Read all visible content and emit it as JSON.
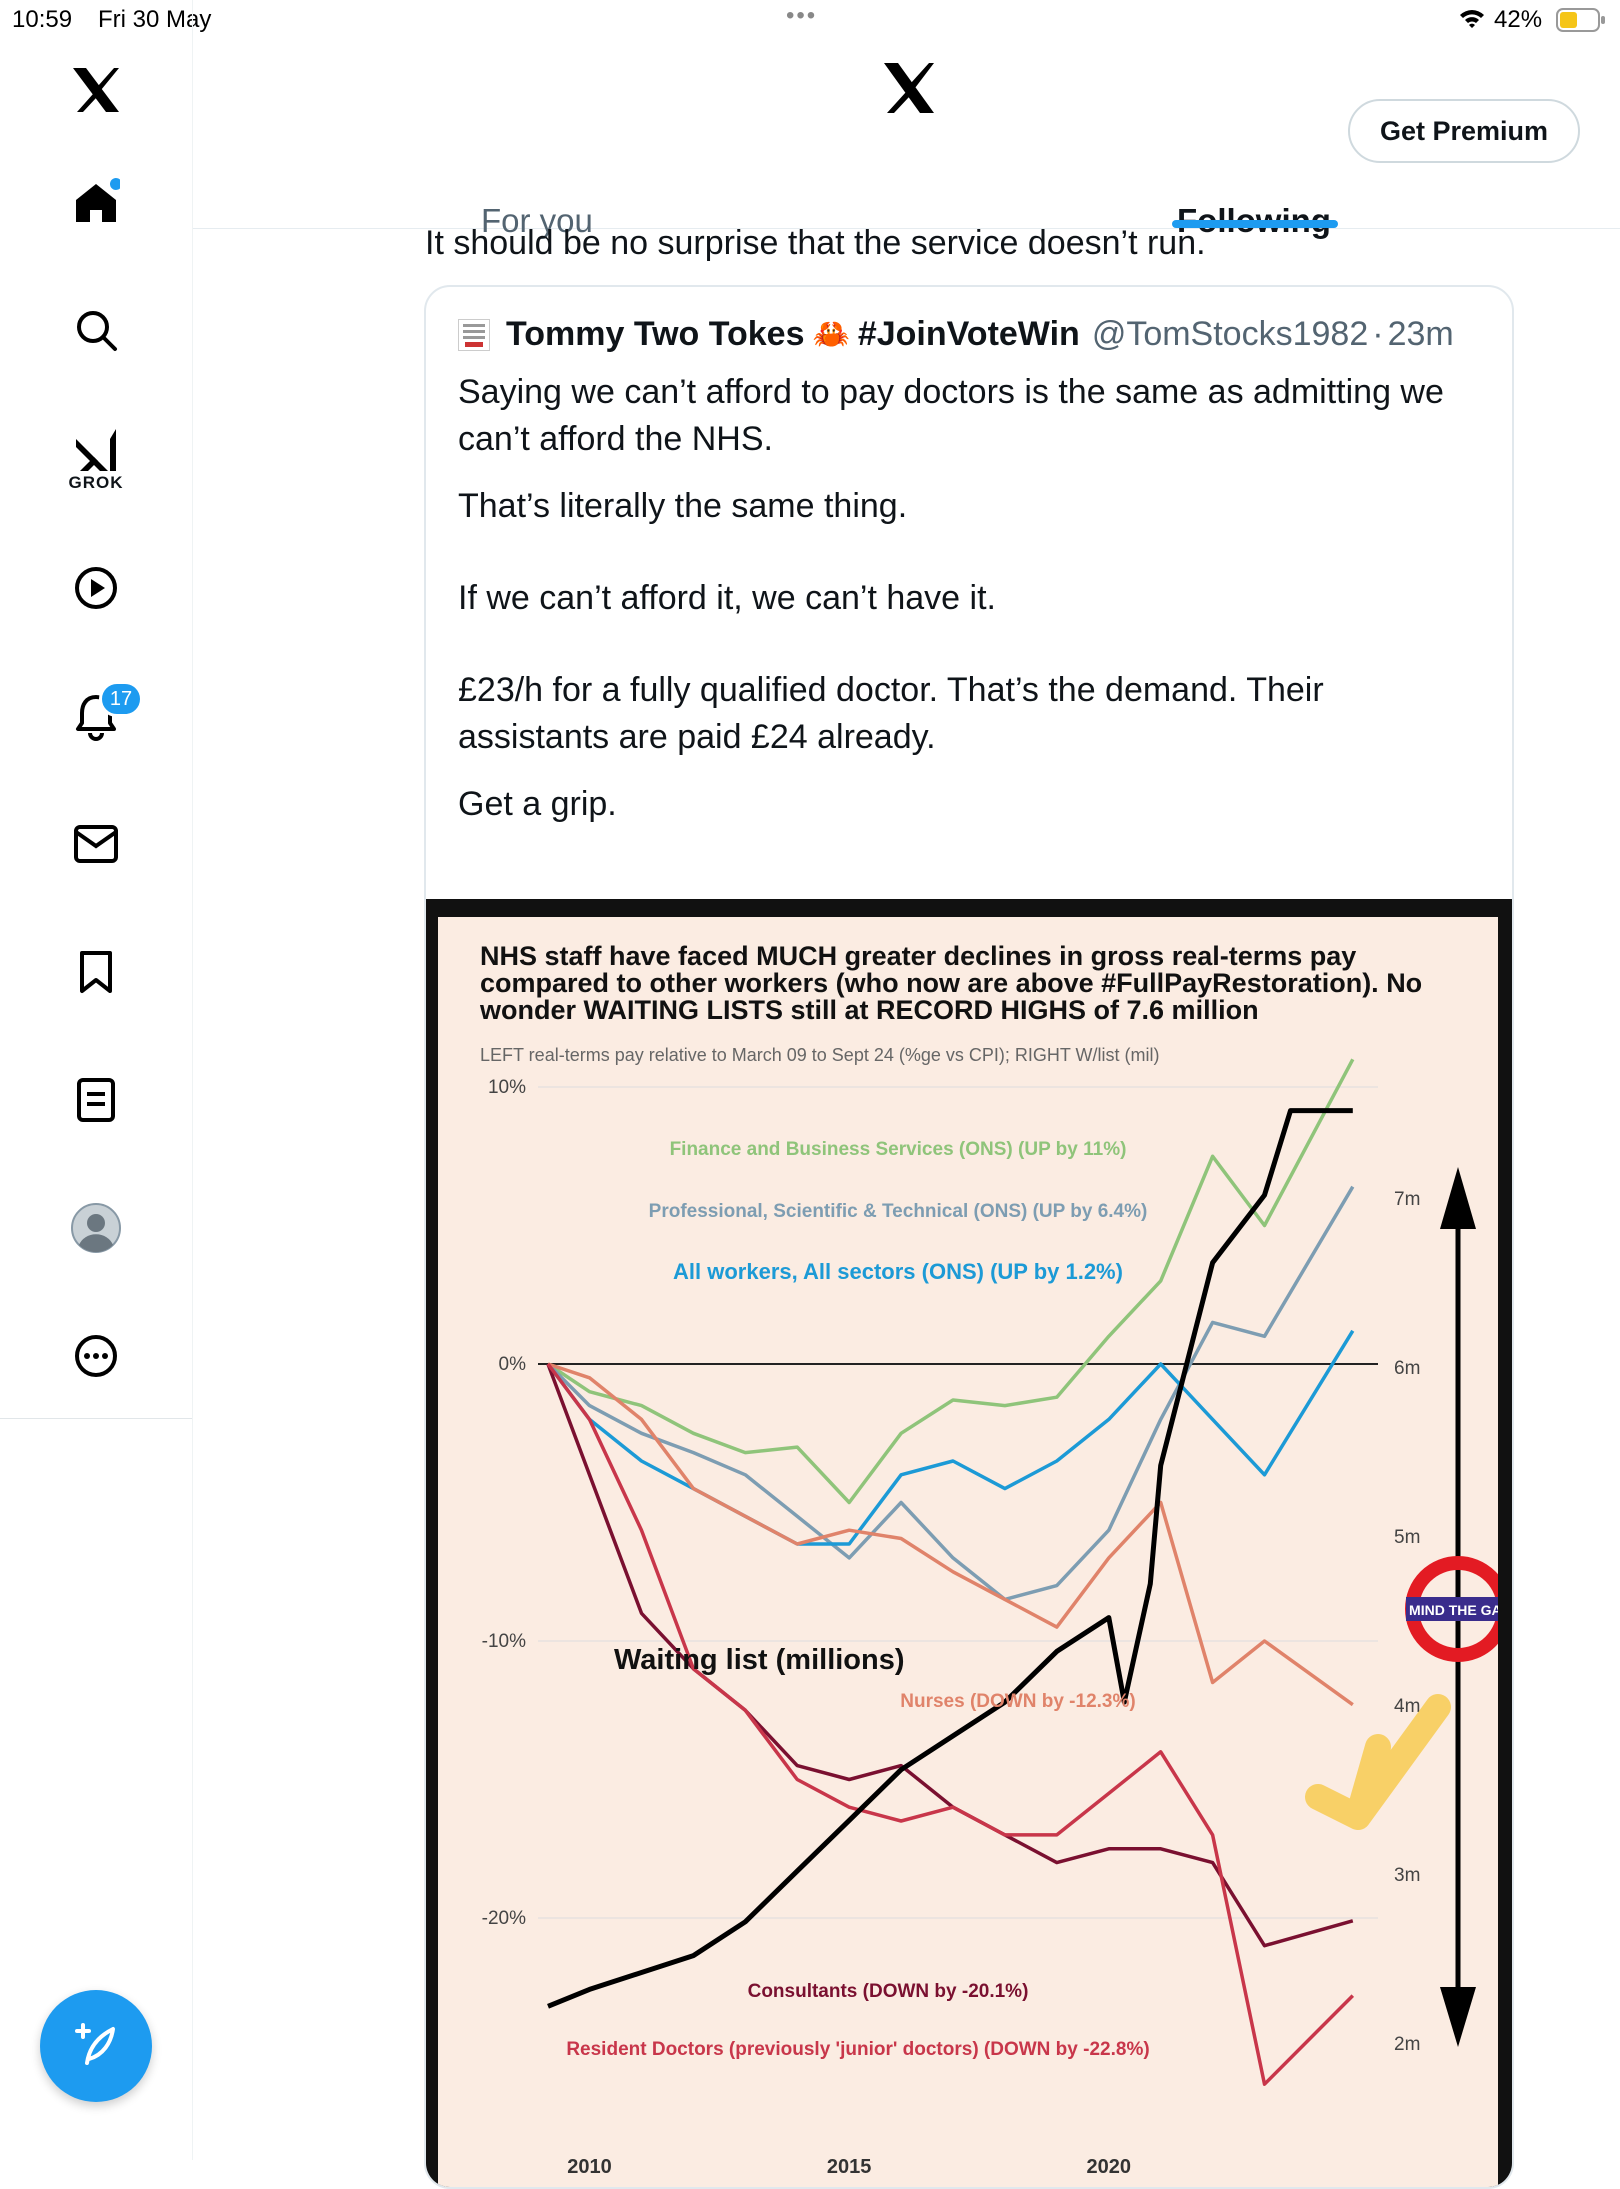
{
  "status": {
    "time": "10:59",
    "date": "Fri 30 May",
    "dots": "•••",
    "battery": "42%"
  },
  "sidebar": {
    "items": [
      {
        "name": "x-logo-icon"
      },
      {
        "name": "home-icon"
      },
      {
        "name": "search-icon"
      },
      {
        "name": "grok-icon",
        "label": "GROK"
      },
      {
        "name": "video-icon"
      },
      {
        "name": "notifications-icon",
        "badge": "17"
      },
      {
        "name": "messages-icon"
      },
      {
        "name": "bookmarks-icon"
      },
      {
        "name": "lists-icon"
      },
      {
        "name": "profile-icon"
      },
      {
        "name": "more-icon"
      }
    ]
  },
  "header": {
    "get_premium": "Get Premium",
    "tabs": [
      "For you",
      "Following"
    ],
    "active_tab": "Following"
  },
  "tweet": {
    "text_fragment": "It should be no surprise that the service doesn’t run.",
    "quote": {
      "name": "Tommy Two Tokes",
      "emoji": "🦀",
      "hashtag": "#JoinVoteWin",
      "handle": "@TomStocks1982",
      "sep": "·",
      "time": "23m",
      "paragraphs": [
        "Saying we can’t afford to pay doctors is the same as admitting we can’t afford the NHS.",
        "That’s literally the same thing.",
        "If we can’t afford it, we can’t have it.",
        "£23/h for a fully qualified doctor. That’s the demand. Their assistants are paid £24 already.",
        "Get a grip."
      ]
    }
  },
  "chart_data": {
    "type": "line",
    "title": "NHS staff have faced MUCH greater declines in gross real-terms pay compared to other workers (who now are above #FullPayRestoration). No wonder WAITING LISTS still at RECORD HIGHS of 7.6 million",
    "subtitle": "LEFT real-terms pay relative to March 09 to Sept 24 (%ge vs CPI); RIGHT W/list (mil)",
    "x_ticks": [
      "2010",
      "2015",
      "2020"
    ],
    "y_left_ticks": [
      "10%",
      "0%",
      "-10%",
      "-20%"
    ],
    "y_right_ticks": [
      "7m",
      "6m",
      "5m",
      "4m",
      "3m",
      "2m"
    ],
    "xlim": [
      2009.2,
      2024.8
    ],
    "ylim_left": [
      -20,
      10
    ],
    "ylim_right": [
      2,
      7
    ],
    "series": [
      {
        "name": "Finance and Business Services (ONS) (UP by 11%)",
        "color": "#8fc47a",
        "x": [
          2009.2,
          2010,
          2011,
          2012,
          2013,
          2014,
          2015,
          2016,
          2017,
          2018,
          2019,
          2020,
          2021,
          2022,
          2023,
          2024.7
        ],
        "y": [
          0,
          -1,
          -1.5,
          -2.5,
          -3.2,
          -3,
          -5,
          -2.5,
          -1.3,
          -1.5,
          -1.2,
          1,
          3,
          7.5,
          5,
          11
        ]
      },
      {
        "name": "Professional, Scientific & Technical (ONS) (UP by 6.4%)",
        "color": "#7d9db2",
        "x": [
          2009.2,
          2010,
          2011,
          2012,
          2013,
          2014,
          2015,
          2016,
          2017,
          2018,
          2019,
          2020,
          2021,
          2022,
          2023,
          2024.7
        ],
        "y": [
          0,
          -1.5,
          -2.5,
          -3.2,
          -4,
          -5.5,
          -7,
          -5,
          -7,
          -8.5,
          -8,
          -6,
          -2,
          1.5,
          1,
          6.4
        ]
      },
      {
        "name": "All workers, All sectors (ONS) (UP by 1.2%)",
        "color": "#1c9ad6",
        "x": [
          2009.2,
          2010,
          2011,
          2012,
          2013,
          2014,
          2015,
          2016,
          2017,
          2018,
          2019,
          2020,
          2021,
          2022,
          2023,
          2024.7
        ],
        "y": [
          0,
          -2,
          -3.5,
          -4.5,
          -5.5,
          -6.5,
          -6.5,
          -4,
          -3.5,
          -4.5,
          -3.5,
          -2,
          0,
          -2,
          -4,
          1.2
        ]
      },
      {
        "name": "Nurses (DOWN by -12.3%)",
        "color": "#e0836a",
        "x": [
          2009.2,
          2010,
          2011,
          2012,
          2013,
          2014,
          2015,
          2016,
          2017,
          2018,
          2019,
          2020,
          2021,
          2022,
          2023,
          2024.7
        ],
        "y": [
          0,
          -0.5,
          -2,
          -4.5,
          -5.5,
          -6.5,
          -6,
          -6.3,
          -7.5,
          -8.5,
          -9.5,
          -7,
          -5,
          -11.5,
          -10,
          -12.3
        ]
      },
      {
        "name": "Consultants (DOWN by -20.1%)",
        "color": "#7a1030",
        "x": [
          2009.2,
          2010,
          2011,
          2012,
          2013,
          2014,
          2015,
          2016,
          2017,
          2018,
          2019,
          2020,
          2021,
          2022,
          2023,
          2024.7
        ],
        "y": [
          0,
          -4,
          -9,
          -11,
          -12.5,
          -14.5,
          -15,
          -14.5,
          -16,
          -17,
          -18,
          -17.5,
          -17.5,
          -18,
          -21,
          -20.1
        ]
      },
      {
        "name": "Resident Doctors (previously 'junior' doctors) (DOWN by -22.8%)",
        "color": "#c8364a",
        "x": [
          2009.2,
          2010,
          2011,
          2012,
          2013,
          2014,
          2015,
          2016,
          2017,
          2018,
          2019,
          2020,
          2021,
          2022,
          2023,
          2024.7
        ],
        "y": [
          0,
          -2,
          -6,
          -11,
          -12.5,
          -15,
          -16,
          -16.5,
          -16,
          -17,
          -17,
          -15.5,
          -14,
          -17,
          -26,
          -22.8
        ]
      },
      {
        "name": "Waiting list (millions)",
        "color": "#000000",
        "axis": "right",
        "x": [
          2009.2,
          2010,
          2011,
          2012,
          2013,
          2014,
          2015,
          2016,
          2017,
          2018,
          2019,
          2020,
          2020.3,
          2020.8,
          2021,
          2022,
          2023,
          2023.5,
          2024.7
        ],
        "y": [
          2.3,
          2.4,
          2.5,
          2.6,
          2.8,
          3.1,
          3.4,
          3.7,
          3.9,
          4.1,
          4.4,
          4.6,
          4.1,
          4.8,
          5.5,
          6.7,
          7.1,
          7.6,
          7.6
        ]
      }
    ],
    "annotations": {
      "arrow_label": "MIND THE GAP",
      "left_axis_label": "",
      "right_axis_label": ""
    }
  }
}
